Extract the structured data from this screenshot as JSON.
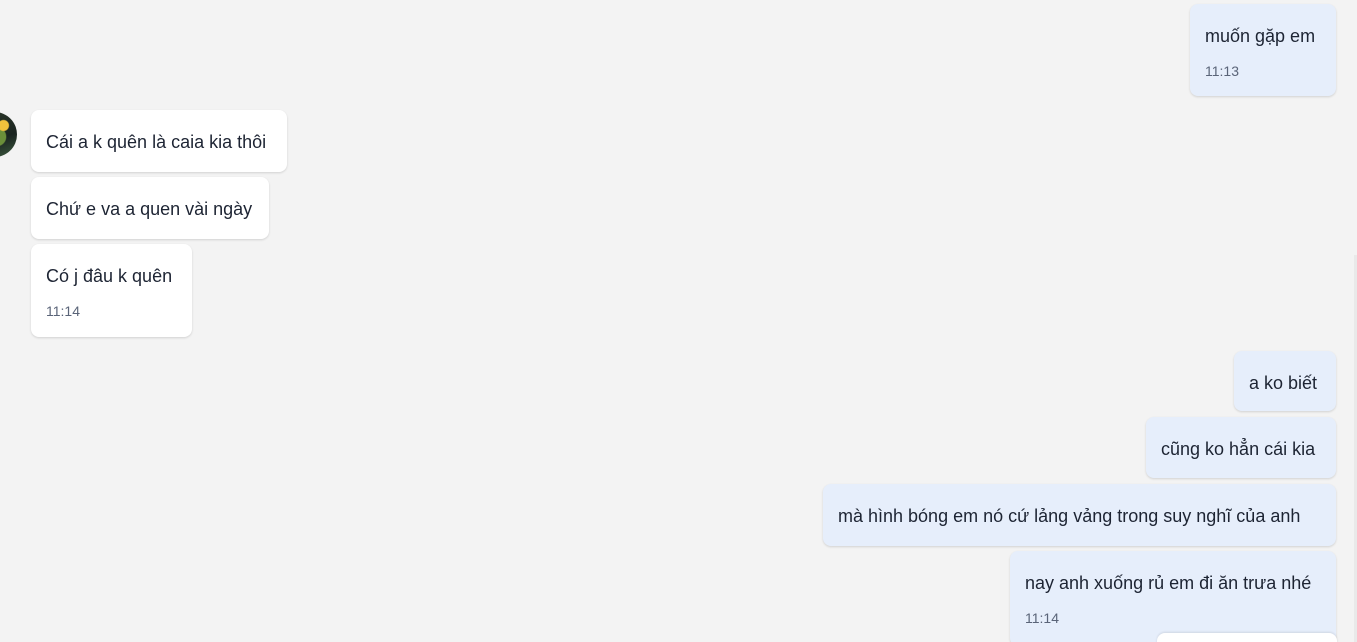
{
  "messages": [
    {
      "side": "out",
      "text": "muốn gặp em",
      "time": "11:13"
    },
    {
      "side": "in",
      "text": "Cái a k quên là caia kia thôi"
    },
    {
      "side": "in",
      "text": "Chứ e va a quen vài ngày"
    },
    {
      "side": "in",
      "text": "Có j đâu k quên",
      "time": "11:14"
    },
    {
      "side": "out",
      "text": "a ko biết"
    },
    {
      "side": "out",
      "text": "cũng ko hẳn cái kia"
    },
    {
      "side": "out",
      "text": "mà hình bóng em nó cứ lảng vảng trong suy nghĩ của anh"
    },
    {
      "side": "out",
      "text": "nay anh xuống rủ em đi ăn trưa nhé",
      "time": "11:14"
    }
  ],
  "colors": {
    "background": "#f3f3f3",
    "incoming_bubble": "#ffffff",
    "outgoing_bubble": "#e6eefb",
    "text": "#1d2433",
    "time": "#5a6478"
  }
}
